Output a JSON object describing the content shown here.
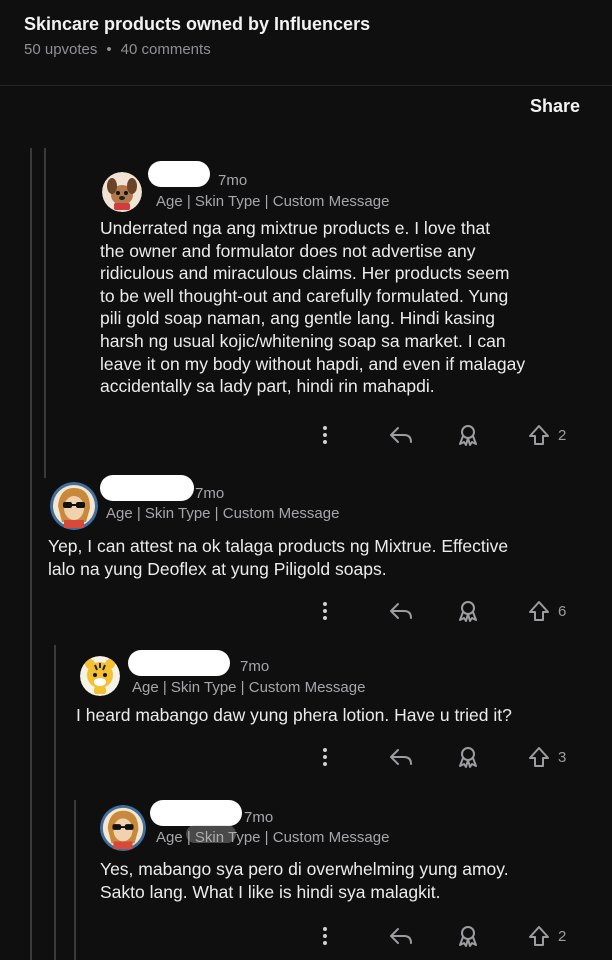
{
  "post": {
    "title": "Skincare products owned by Influencers",
    "upvotes": "50 upvotes",
    "separator": "•",
    "comments": "40 comments"
  },
  "share_label": "Share",
  "comments": [
    {
      "time": "7mo",
      "flair": "Age | Skin Type | Custom Message",
      "text_lines": [
        "Underrated nga ang mixtrue products e. I love that",
        "the owner and formulator does not advertise any",
        "ridiculous and miraculous claims. Her products seem",
        "to be well thought-out and carefully formulated. Yung",
        "pili gold soap naman, ang gentle lang. Hindi kasing",
        "harsh ng usual kojic/whitening soap sa market. I can",
        "leave it on my body without hapdi, and even if malagay",
        "accidentally sa lady part, hindi rin mahapdi."
      ],
      "votes": "2",
      "avatar": "dog-avatar"
    },
    {
      "time": "7mo",
      "flair": "Age | Skin Type | Custom Message",
      "text_lines": [
        "Yep, I can attest na ok talaga products ng Mixtrue. Effective",
        "lalo na yung Deoflex at yung Piligold soaps."
      ],
      "votes": "6",
      "avatar": "sunglasses-avatar"
    },
    {
      "time": "7mo",
      "flair": "Age | Skin Type | Custom Message",
      "text_lines": [
        "I heard mabango daw yung phera lotion. Have u tried it?"
      ],
      "votes": "3",
      "avatar": "tiger-avatar"
    },
    {
      "time": "7mo",
      "flair": "Age | Skin Type | Custom Message",
      "text_lines": [
        "Yes, mabango sya pero di overwhelming yung amoy.",
        "Sakto lang. What I like is hindi sya malagkit."
      ],
      "votes": "2",
      "avatar": "sunglasses-avatar"
    }
  ],
  "icons": [
    "more-icon",
    "reply-icon",
    "award-icon",
    "upvote-icon"
  ]
}
